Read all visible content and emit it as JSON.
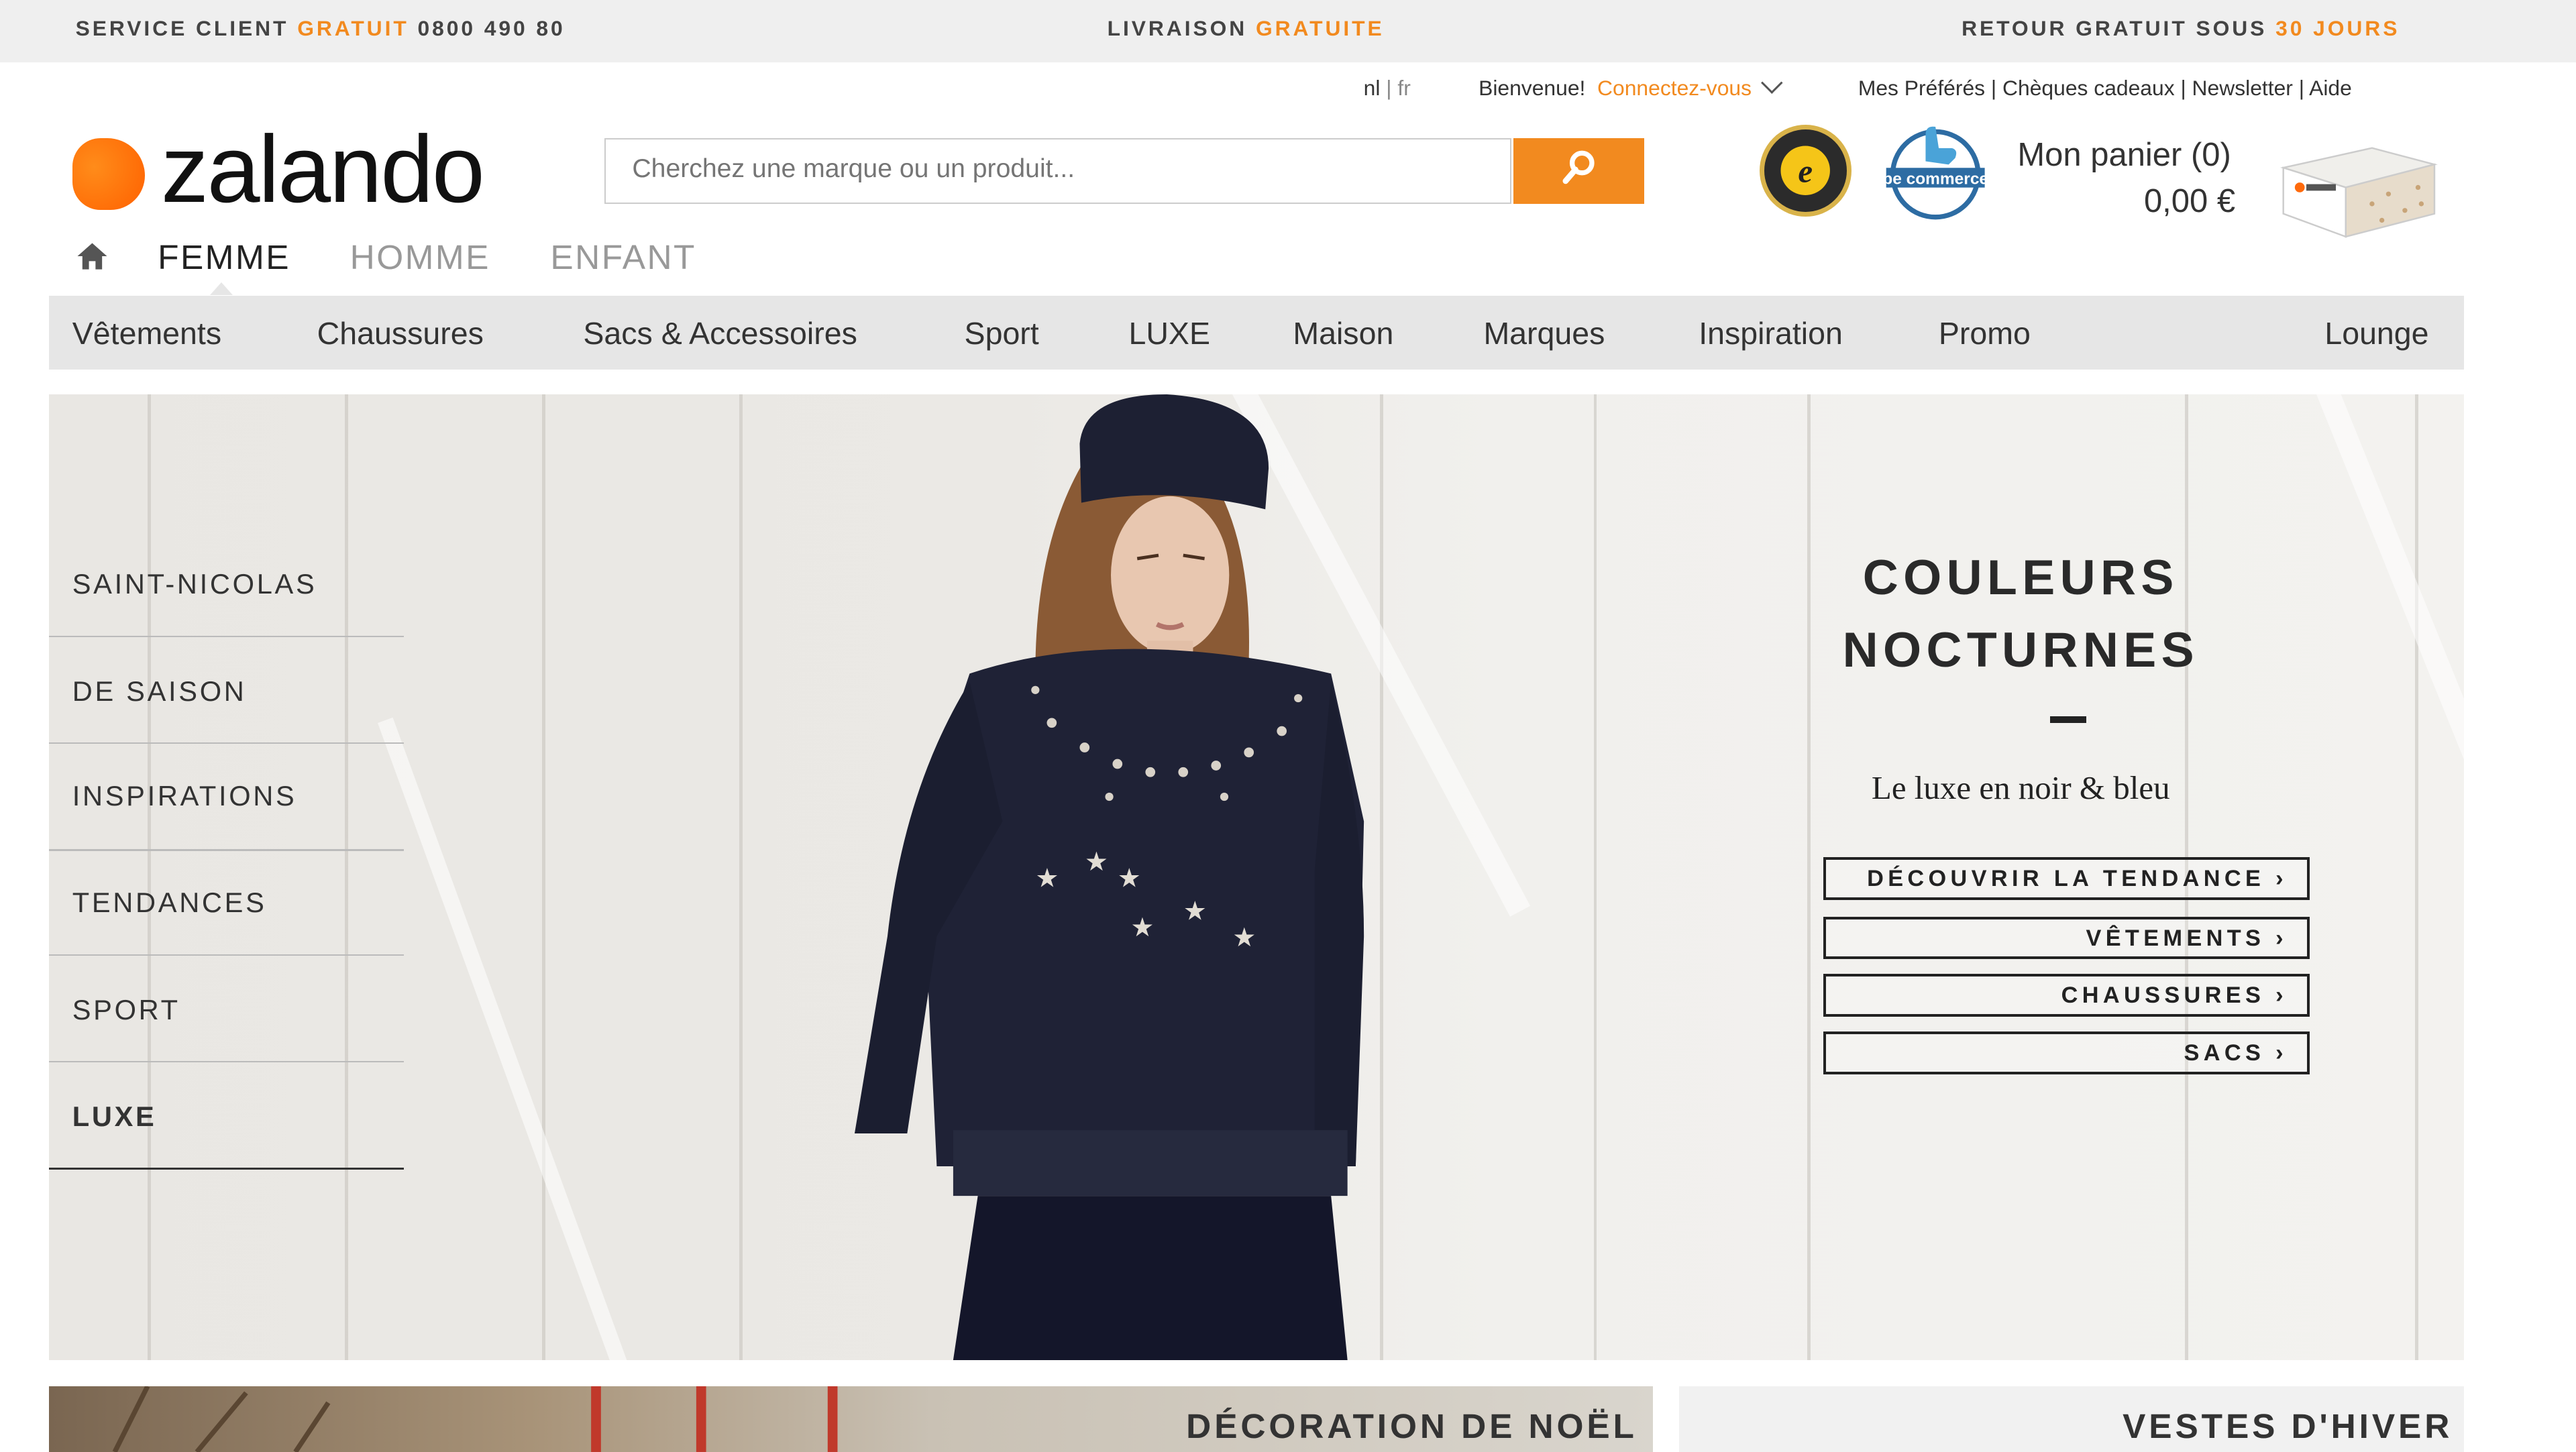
{
  "topbar": {
    "service_prefix": "SERVICE CLIENT",
    "service_highlight": "GRATUIT",
    "service_phone": "0800 490 80",
    "delivery_prefix": "LIVRAISON",
    "delivery_highlight": "GRATUITE",
    "return_prefix": "RETOUR GRATUIT SOUS",
    "return_highlight": "30 JOURS"
  },
  "utility": {
    "lang_nl": "nl",
    "lang_sep": "|",
    "lang_fr": "fr",
    "welcome": "Bienvenue!",
    "login": "Connectez-vous",
    "links": "Mes Préférés | Chèques cadeaux | Newsletter | Aide"
  },
  "logo": {
    "text": "zalando"
  },
  "search": {
    "placeholder": "Cherchez une marque ou un produit..."
  },
  "cart": {
    "label": "Mon panier (0)",
    "amount": "0,00 €"
  },
  "gender_tabs": [
    {
      "label": "FEMME",
      "active": true
    },
    {
      "label": "HOMME",
      "active": false
    },
    {
      "label": "ENFANT",
      "active": false
    }
  ],
  "categories": [
    "Vêtements",
    "Chaussures",
    "Sacs & Accessoires",
    "Sport",
    "LUXE",
    "Maison",
    "Marques",
    "Inspiration",
    "Promo",
    "Lounge"
  ],
  "side_menu": [
    "SAINT-NICOLAS",
    "DE SAISON",
    "INSPIRATIONS",
    "TENDANCES",
    "SPORT",
    "LUXE"
  ],
  "hero": {
    "headline_line1": "COULEURS",
    "headline_line2": "NOCTURNES",
    "tagline": "Le luxe en noir & bleu",
    "ctas": [
      "DÉCOUVRIR LA TENDANCE ›",
      "VÊTEMENTS ›",
      "CHAUSSURES ›",
      "SACS ›"
    ]
  },
  "tiles": {
    "left_title": "DÉCORATION DE NOËL",
    "right_title": "VESTES D'HIVER"
  },
  "colors": {
    "accent": "#f28a1f",
    "logo": "#ff6a0c"
  }
}
